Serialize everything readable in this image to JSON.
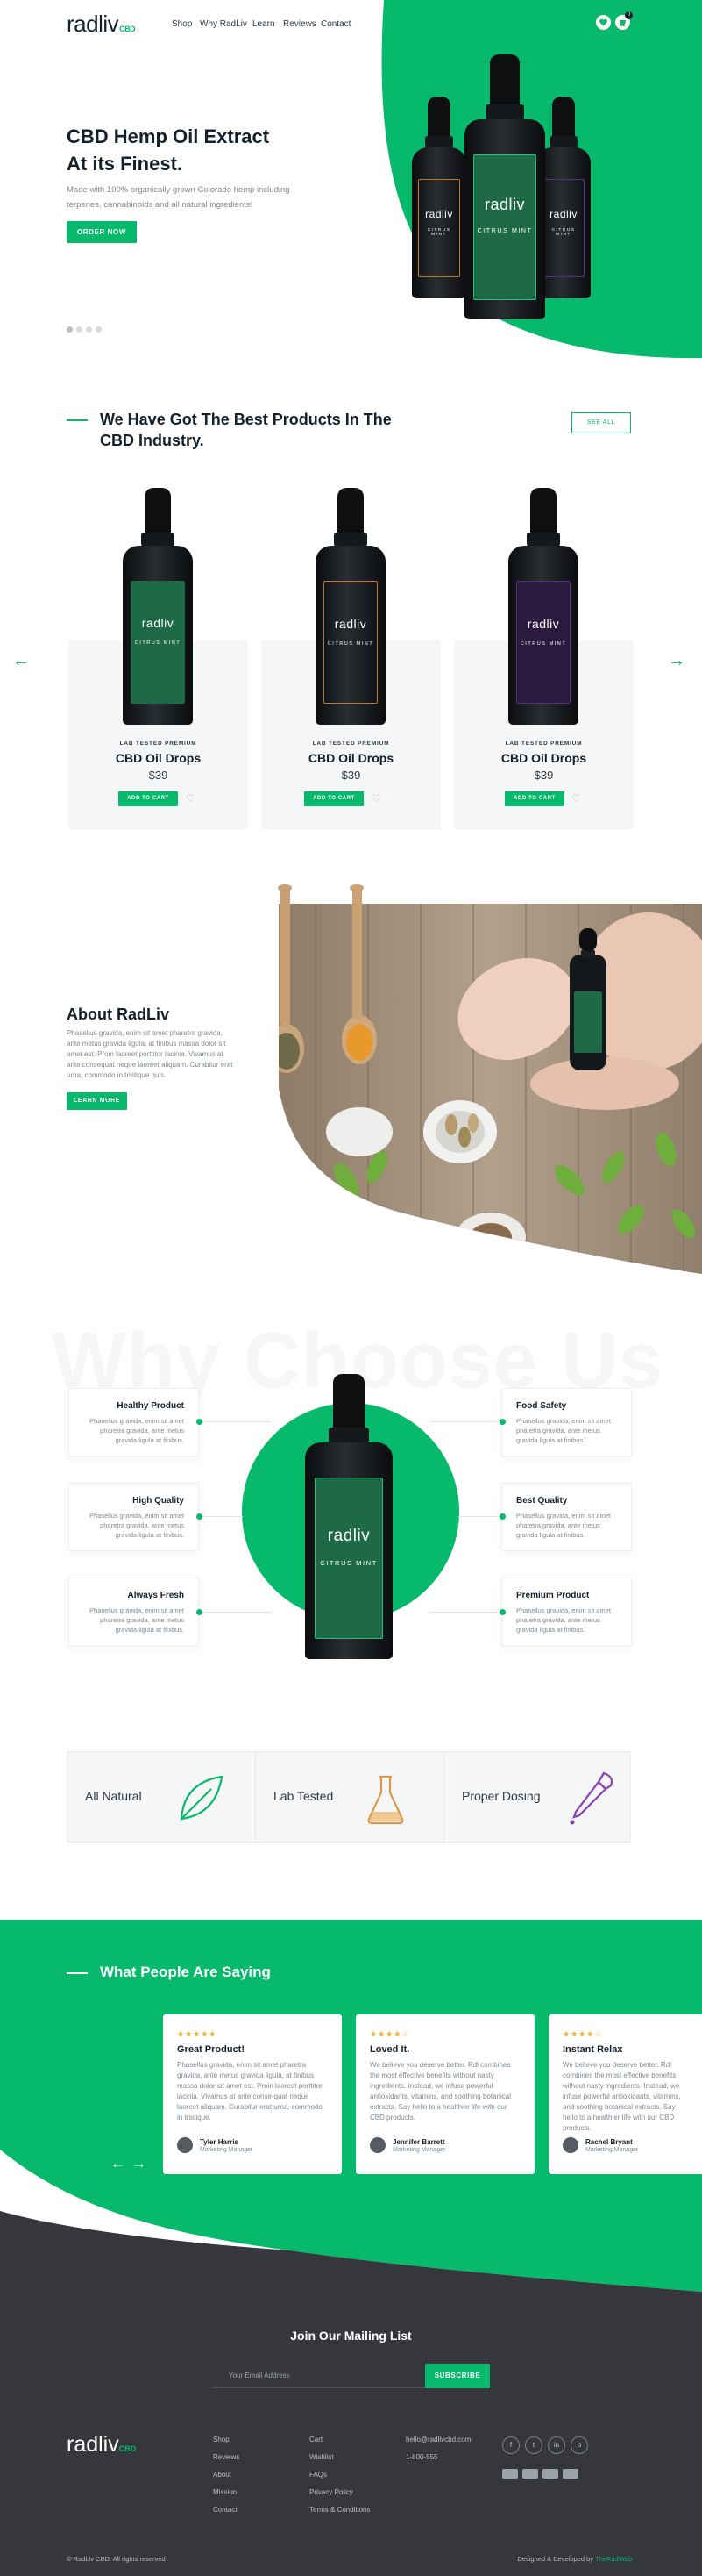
{
  "brand": {
    "name": "radliv",
    "suffix": "CBD"
  },
  "colors": {
    "accent": "#07b96a",
    "dark": "#35373c",
    "text": "#14202a"
  },
  "nav": {
    "links": [
      "Shop",
      "Why RadLiv",
      "Learn",
      "Reviews",
      "Contact"
    ],
    "icons": [
      "heart-icon",
      "cart-icon"
    ],
    "cart_count": "0"
  },
  "hero": {
    "title_line1": "CBD Hemp Oil Extract",
    "title_line2": "At its Finest.",
    "subtitle": "Made with 100% organically grown Colorado hemp including terpenes, cannabinoids and all natural ingredients!",
    "button": "ORDER NOW",
    "bottle_logo": "radliv",
    "bottle_flavor": "CITRUS MINT"
  },
  "products": {
    "heading_line1": "We Have Got The Best Products In The",
    "heading_line2": "CBD Industry.",
    "see_all": "SEE ALL",
    "items": [
      {
        "tag": "LAB TESTED PREMIUM",
        "name": "CBD Oil Drops",
        "price": "$39",
        "button": "ADD TO CART",
        "color": "#1f6a46"
      },
      {
        "tag": "LAB TESTED PREMIUM",
        "name": "CBD Oil Drops",
        "price": "$39",
        "button": "ADD TO CART",
        "color": "#c0762a"
      },
      {
        "tag": "LAB TESTED PREMIUM",
        "name": "CBD Oil Drops",
        "price": "$39",
        "button": "ADD TO CART",
        "color": "#5a2d86"
      }
    ]
  },
  "about": {
    "title": "About RadLiv",
    "text": "Phasellus gravida, enim sit amet pharetra gravida, ante metus gravida ligula, at finibus massa dolor sit amet est. Proin laoreet porttitor lacinia. Vivamus at ante consequat neque laoreet aliquam. Curabitur erat urna, commodo in tristique quis.",
    "button": "LEARN MORE"
  },
  "why": {
    "bg_title": "Why Choose Us",
    "left": [
      {
        "title": "Healthy Product",
        "text": "Phasellus gravida, enim sit amet pharetra gravida, ante metus gravida ligula at finibus."
      },
      {
        "title": "High Quality",
        "text": "Phasellus gravida, enim sit amet pharetra gravida, ante metus gravida ligula at finibus."
      },
      {
        "title": "Always Fresh",
        "text": "Phasellus gravida, enim sit amet pharetra gravida, ante metus gravida ligula at finibus."
      }
    ],
    "right": [
      {
        "title": "Food Safety",
        "text": "Phasellus gravida, enim sit amet pharetra gravida, ante metus gravida ligula at finibus."
      },
      {
        "title": "Best Quality",
        "text": "Phasellus gravida, enim sit amet pharetra gravida, ante metus gravida ligula at finibus."
      },
      {
        "title": "Premium Product",
        "text": "Phasellus gravida, enim sit amet pharetra gravida, ante metus gravida ligula at finibus."
      }
    ]
  },
  "badges": [
    {
      "label": "All Natural",
      "icon": "leaf-icon"
    },
    {
      "label": "Lab Tested",
      "icon": "flask-icon"
    },
    {
      "label": "Proper Dosing",
      "icon": "dropper-icon"
    }
  ],
  "testimonials": {
    "heading": "What People Are Saying",
    "items": [
      {
        "stars": "★★★★★",
        "title": "Great Product!",
        "text": "Phasellus gravida, enim sit amet pharetra gravida, ante metus gravida ligula, at finibus massa dolor sit amet est. Proin laoreet porttitor lacinia. Vivamus at ante conse-quat neque laoreet aliquam. Curabitur erat urna, commodo in tristique.",
        "name": "Tyler Harris",
        "role": "Marketing Manager"
      },
      {
        "stars": "★★★★☆",
        "title": "Loved It.",
        "text": "We believe you deserve better. Rdl combines the most effective benefits without nasty ingredients. Instead, we infuse powerful antioxidants, vitamins, and soothing botanical extracts. Say hello to a healthier life with our CBD products.",
        "name": "Jennifer Barrett",
        "role": "Marketing Manager"
      },
      {
        "stars": "★★★★☆",
        "title": "Instant Relax",
        "text": "We believe you deserve better. Rdl combines the most effective benefits without nasty ingredients. Instead, we infuse powerful antioxidants, vitamins, and soothing botanical extracts. Say hello to a healthier life with our CBD products.",
        "name": "Rachel Bryant",
        "role": "Marketing Manager"
      }
    ]
  },
  "footer": {
    "mail_title": "Join Our Mailing List",
    "mail_placeholder": "Your Email Address",
    "mail_button": "SUBSCRIBE",
    "col1": [
      "Shop",
      "Reviews",
      "About",
      "Mission",
      "Contact"
    ],
    "col2": [
      "Cart",
      "Wishlist",
      "FAQs",
      "Privacy Policy",
      "Terms & Conditions"
    ],
    "email": "hello@radlivcbd.com",
    "phone": "1-800-555",
    "social": [
      "f",
      "t",
      "in",
      "p"
    ],
    "copyright": "© RadLiv CBD. All rights reserved",
    "credit_prefix": "Designed & Developed by",
    "credit_name": "TheRadWeb"
  }
}
